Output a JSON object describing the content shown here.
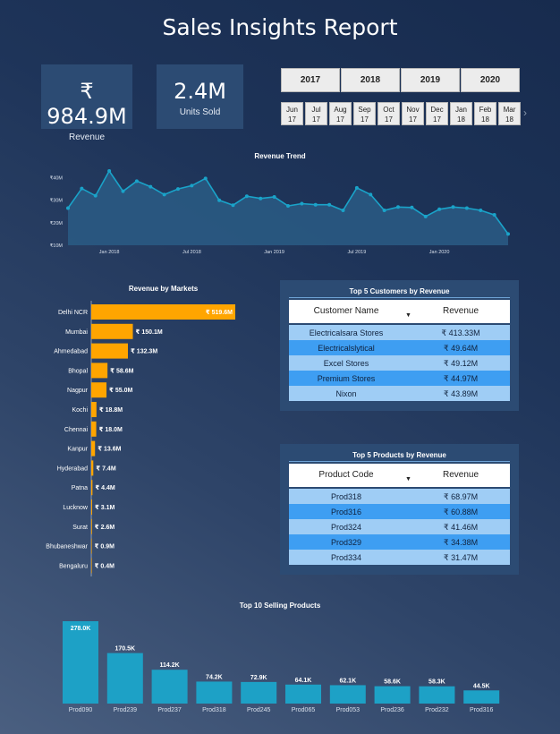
{
  "title": "Sales Insights Report",
  "kpis": {
    "revenue": {
      "value": "₹ 984.9M",
      "label": "Revenue"
    },
    "units": {
      "value": "2.4M",
      "label": "Units Sold"
    }
  },
  "years": [
    "2017",
    "2018",
    "2019",
    "2020"
  ],
  "months": [
    {
      "m": "Jun",
      "y": "17"
    },
    {
      "m": "Jul",
      "y": "17"
    },
    {
      "m": "Aug",
      "y": "17"
    },
    {
      "m": "Sep",
      "y": "17"
    },
    {
      "m": "Oct",
      "y": "17"
    },
    {
      "m": "Nov",
      "y": "17"
    },
    {
      "m": "Dec",
      "y": "17"
    },
    {
      "m": "Jan",
      "y": "18"
    },
    {
      "m": "Feb",
      "y": "18"
    },
    {
      "m": "Mar",
      "y": "18"
    }
  ],
  "customers_table": {
    "title": "Top 5 Customers by Revenue",
    "col1": "Customer Name",
    "col2": "Revenue",
    "rows": [
      {
        "name": "Electricalsara Stores",
        "value": "₹ 413.33M"
      },
      {
        "name": "Electricalslytical",
        "value": "₹ 49.64M"
      },
      {
        "name": "Excel Stores",
        "value": "₹ 49.12M"
      },
      {
        "name": "Premium Stores",
        "value": "₹ 44.97M"
      },
      {
        "name": "Nixon",
        "value": "₹ 43.89M"
      }
    ]
  },
  "products_table": {
    "title": "Top 5 Products by Revenue",
    "col1": "Product Code",
    "col2": "Revenue",
    "rows": [
      {
        "name": "Prod318",
        "value": "₹ 68.97M"
      },
      {
        "name": "Prod316",
        "value": "₹ 60.88M"
      },
      {
        "name": "Prod324",
        "value": "₹ 41.46M"
      },
      {
        "name": "Prod329",
        "value": "₹ 34.38M"
      },
      {
        "name": "Prod334",
        "value": "₹ 31.47M"
      }
    ]
  },
  "colors": {
    "line": "#1aa3c9",
    "area": "#2a5c85",
    "bar_markets": "#ffa500",
    "bar_products": "#1da1c6"
  },
  "chart_data": [
    {
      "type": "area",
      "title": "Revenue Trend",
      "unit": "M",
      "x": [
        "2017-10",
        "2017-11",
        "2017-12",
        "2018-01",
        "2018-02",
        "2018-03",
        "2018-04",
        "2018-05",
        "2018-06",
        "2018-07",
        "2018-08",
        "2018-09",
        "2018-10",
        "2018-11",
        "2018-12",
        "2019-01",
        "2019-02",
        "2019-03",
        "2019-04",
        "2019-05",
        "2019-06",
        "2019-07",
        "2019-08",
        "2019-09",
        "2019-10",
        "2019-11",
        "2019-12",
        "2020-01",
        "2020-02",
        "2020-03",
        "2020-04",
        "2020-05",
        "2020-06"
      ],
      "values": [
        26.5,
        35.2,
        32.0,
        43.0,
        34.0,
        38.5,
        36.0,
        32.5,
        35.0,
        36.5,
        39.7,
        30.0,
        27.8,
        31.8,
        30.8,
        31.5,
        27.5,
        28.5,
        28.0,
        28.0,
        25.5,
        35.5,
        32.5,
        25.5,
        27.0,
        26.8,
        22.8,
        26.0,
        27.0,
        26.5,
        25.5,
        23.5,
        15.0
      ],
      "x_ticks": [
        {
          "label": "Jan 2018",
          "x": "2018-01"
        },
        {
          "label": "Jul 2018",
          "x": "2018-07"
        },
        {
          "label": "Jan 2019",
          "x": "2019-01"
        },
        {
          "label": "Jul 2019",
          "x": "2019-07"
        },
        {
          "label": "Jan 2020",
          "x": "2020-01"
        }
      ],
      "y_ticks": [
        {
          "label": "₹10M",
          "v": 10
        },
        {
          "label": "₹20M",
          "v": 20
        },
        {
          "label": "₹30M",
          "v": 30
        },
        {
          "label": "₹40M",
          "v": 40
        }
      ],
      "ylim": [
        10,
        45
      ],
      "grid": false
    },
    {
      "type": "bar",
      "orientation": "horizontal",
      "title": "Revenue by Markets",
      "categories": [
        "Delhi NCR",
        "Mumbai",
        "Ahmedabad",
        "Bhopal",
        "Nagpur",
        "Kochi",
        "Chennai",
        "Kanpur",
        "Hyderabad",
        "Patna",
        "Lucknow",
        "Surat",
        "Bhubaneshwar",
        "Bengaluru"
      ],
      "values": [
        519.6,
        150.1,
        132.3,
        58.6,
        55.0,
        18.8,
        18.0,
        13.6,
        7.4,
        4.4,
        3.1,
        2.6,
        0.9,
        0.4
      ],
      "labels": [
        "₹ 519.6M",
        "₹ 150.1M",
        "₹ 132.3M",
        "₹ 58.6M",
        "₹ 55.0M",
        "₹ 18.8M",
        "₹ 18.0M",
        "₹ 13.6M",
        "₹ 7.4M",
        "₹ 4.4M",
        "₹ 3.1M",
        "₹ 2.6M",
        "₹ 0.9M",
        "₹ 0.4M"
      ]
    },
    {
      "type": "bar",
      "title": "Top 10 Selling Products",
      "categories": [
        "Prod090",
        "Prod239",
        "Prod237",
        "Prod318",
        "Prod245",
        "Prod065",
        "Prod053",
        "Prod236",
        "Prod232",
        "Prod316"
      ],
      "values": [
        278.0,
        170.5,
        114.2,
        74.2,
        72.9,
        64.1,
        62.1,
        58.6,
        58.3,
        44.5
      ],
      "labels": [
        "278.0K",
        "170.5K",
        "114.2K",
        "74.2K",
        "72.9K",
        "64.1K",
        "62.1K",
        "58.6K",
        "58.3K",
        "44.5K"
      ]
    }
  ]
}
